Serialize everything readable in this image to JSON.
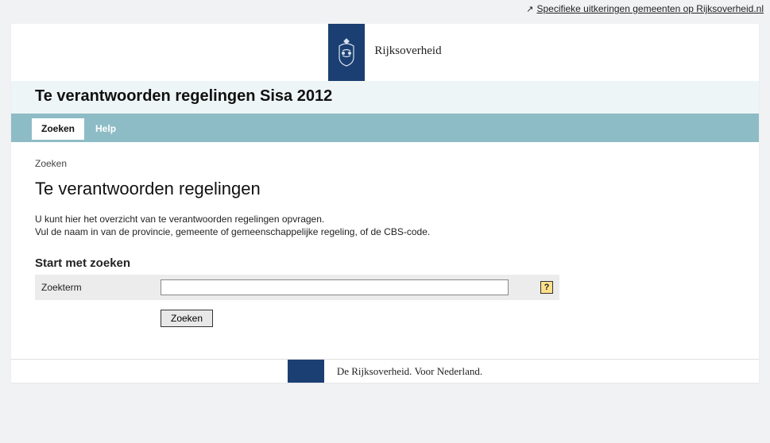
{
  "top_link": {
    "text": "Specifieke uitkeringen gemeenten op Rijksoverheid.nl"
  },
  "logo": {
    "text": "Rijksoverheid"
  },
  "title": "Te verantwoorden regelingen Sisa 2012",
  "tabs": [
    {
      "label": "Zoeken",
      "active": true
    },
    {
      "label": "Help",
      "active": false
    }
  ],
  "breadcrumb": "Zoeken",
  "heading": "Te verantwoorden regelingen",
  "intro": {
    "line1": "U kunt hier het overzicht van te verantwoorden regelingen opvragen.",
    "line2": "Vul de naam in van de provincie, gemeente of gemeenschappelijke regeling, of de CBS-code."
  },
  "form": {
    "section_title": "Start met zoeken",
    "label": "Zoekterm",
    "value": "",
    "help_label": "?",
    "submit_label": "Zoeken"
  },
  "footer": {
    "text": "De Rijksoverheid. Voor Nederland."
  },
  "colors": {
    "brand_blue": "#1b3f72",
    "band_teal": "#8ebcc6"
  }
}
